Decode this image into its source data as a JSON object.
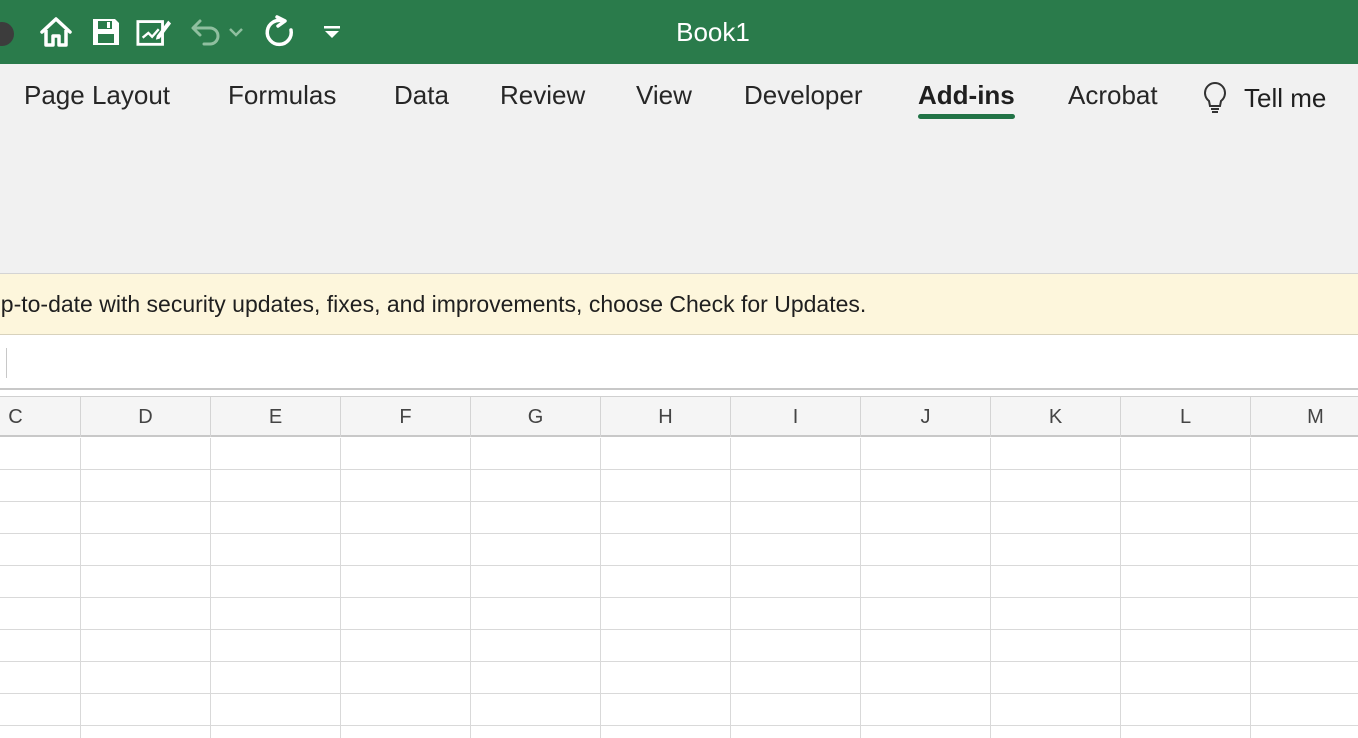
{
  "window": {
    "title": "Book1"
  },
  "quick_access": [
    {
      "name": "home-icon"
    },
    {
      "name": "save-icon"
    },
    {
      "name": "edit-document-icon"
    },
    {
      "name": "undo-icon"
    },
    {
      "name": "undo-dropdown-chevron-icon"
    },
    {
      "name": "redo-icon"
    },
    {
      "name": "customize-toolbar-icon"
    }
  ],
  "ribbon": {
    "tabs": [
      {
        "label": "Page Layout",
        "active": false
      },
      {
        "label": "Formulas",
        "active": false
      },
      {
        "label": "Data",
        "active": false
      },
      {
        "label": "Review",
        "active": false
      },
      {
        "label": "View",
        "active": false
      },
      {
        "label": "Developer",
        "active": false
      },
      {
        "label": "Add-ins",
        "active": true
      },
      {
        "label": "Acrobat",
        "active": false
      }
    ],
    "tell_me": {
      "label": "Tell me",
      "icon": "lightbulb-icon"
    }
  },
  "message_bar": {
    "text": "up-to-date with security updates, fixes, and improvements, choose Check for Updates."
  },
  "formula_bar": {
    "value": ""
  },
  "sheet": {
    "columns": [
      "C",
      "D",
      "E",
      "F",
      "G",
      "H",
      "I",
      "J",
      "K",
      "L",
      "M"
    ]
  },
  "colors": {
    "title_bar": "#2a7b4b",
    "active_tab_underline": "#217346",
    "message_bar": "#fdf6dc"
  }
}
